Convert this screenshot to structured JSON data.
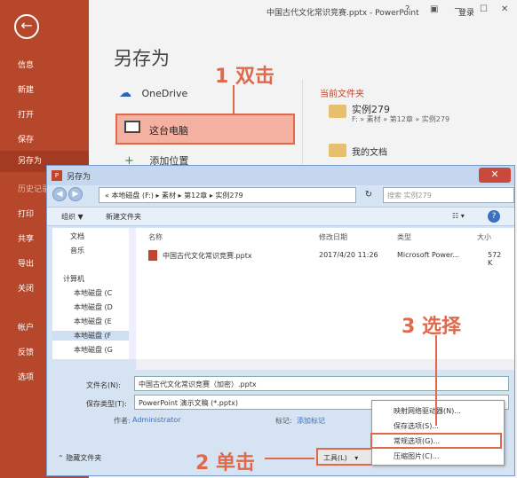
{
  "app": {
    "doc_title": "中国古代文化常识竞赛.pptx - PowerPoint",
    "login": "登录",
    "help": "?"
  },
  "backstage": {
    "heading": "另存为",
    "nav": [
      "信息",
      "新建",
      "打开",
      "保存",
      "另存为",
      "历史记录",
      "打印",
      "共享",
      "导出",
      "关闭",
      "帐户",
      "反馈",
      "选项"
    ],
    "selected": "另存为",
    "places": {
      "onedrive": "OneDrive",
      "this_pc": "这台电脑",
      "add_place": "添加位置"
    },
    "current_folder_label": "当前文件夹",
    "folders": [
      {
        "name": "实例279",
        "path": "F: » 素材 » 第12章 » 实例279"
      },
      {
        "name": "我的文档"
      }
    ]
  },
  "annotations": {
    "step1": "1 双击",
    "step2": "2 单击",
    "step3": "3 选择"
  },
  "dialog": {
    "title": "另存为",
    "breadcrumb": "« 本地磁盘 (F:) ▸ 素材 ▸ 第12章 ▸ 实例279",
    "search_placeholder": "搜索 实例279",
    "organize": "组织 ▼",
    "new_folder": "新建文件夹",
    "nav_items": [
      "文档",
      "音乐",
      "计算机",
      "本地磁盘 (C",
      "本地磁盘 (D",
      "本地磁盘 (E",
      "本地磁盘 (F",
      "本地磁盘 (G"
    ],
    "columns": {
      "name": "名称",
      "date": "修改日期",
      "type": "类型",
      "size": "大小"
    },
    "file": {
      "name": "中国古代文化常识竞赛.pptx",
      "date": "2017/4/20 11:26",
      "type": "Microsoft Power...",
      "size": "572 K"
    },
    "filename_label": "文件名(N):",
    "filename_value": "中国古代文化常识竞赛（加密）.pptx",
    "filetype_label": "保存类型(T):",
    "filetype_value": "PowerPoint 演示文稿 (*.pptx)",
    "author_label": "作者:",
    "author_value": "Administrator",
    "tags_label": "标记:",
    "tags_value": "添加标记",
    "hide_folders": "隐藏文件夹",
    "tools_button": "工具(L)",
    "tools_menu": [
      "映射网络驱动器(N)...",
      "保存选项(S)...",
      "常规选项(G)...",
      "压缩图片(C)..."
    ]
  },
  "colors": {
    "accent": "#b7472a",
    "annotation": "#e0694c"
  }
}
